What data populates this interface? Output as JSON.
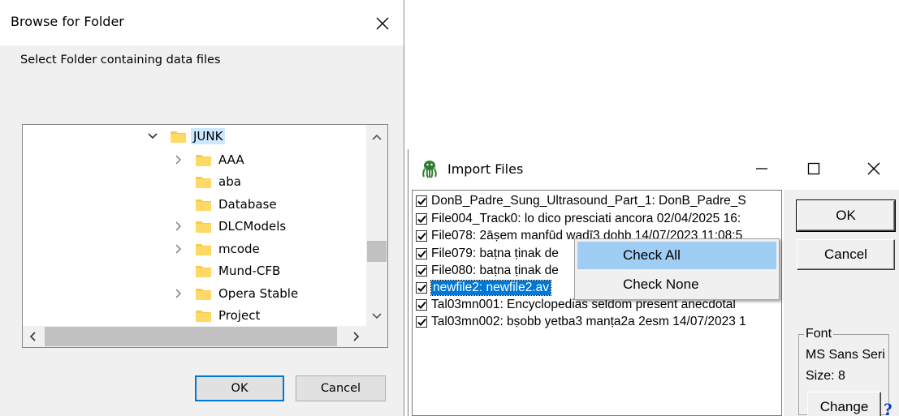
{
  "browse_dialog": {
    "title": "Browse for Folder",
    "prompt": "Select Folder containing data files",
    "tree": [
      {
        "label": "JUNK",
        "expanded": true,
        "selected": true,
        "level": 0
      },
      {
        "label": "AAA",
        "expandable": true,
        "level": 1
      },
      {
        "label": "aba",
        "expandable": false,
        "level": 1
      },
      {
        "label": "Database",
        "expandable": false,
        "level": 1
      },
      {
        "label": "DLCModels",
        "expandable": true,
        "level": 1
      },
      {
        "label": "mcode",
        "expandable": true,
        "level": 1
      },
      {
        "label": "Mund-CFB",
        "expandable": false,
        "level": 1
      },
      {
        "label": "Opera Stable",
        "expandable": true,
        "level": 1
      },
      {
        "label": "Project",
        "expandable": false,
        "level": 1
      }
    ],
    "ok_label": "OK",
    "cancel_label": "Cancel"
  },
  "import_dialog": {
    "title": "Import Files",
    "files": [
      {
        "text": "DonB_Padre_Sung_Ultrasound_Part_1: DonB_Padre_S",
        "checked": true
      },
      {
        "text": "File004_Track0: lo dico presciati ancora 02/04/2025 16:",
        "checked": true
      },
      {
        "text": "File078: 2āṣem manfūd wadī3 dohb 14/07/2023 11:08:5",
        "checked": true
      },
      {
        "text": "File079: baṭna ṭinak de",
        "checked": true
      },
      {
        "text": "File080: baṭna ṭinak de",
        "checked": true
      },
      {
        "text": "newfile2: newfile2.av",
        "checked": true,
        "highlighted": true
      },
      {
        "text": "Tal03mn001: Encyclopedias seldom present anecdotal",
        "checked": true
      },
      {
        "text": "Tal03mn002: bṣobb yetba3 manṭa2a 2esm 14/07/2023 1",
        "checked": true
      }
    ],
    "ok_label": "OK",
    "cancel_label": "Cancel",
    "font_group": {
      "legend": "Font",
      "font_name": "MS Sans Seri",
      "size_text": "Size: 8",
      "change_label": "Change"
    },
    "help_label": "?"
  },
  "context_menu": {
    "items": [
      {
        "label": "Check All",
        "hover": true
      },
      {
        "label": "Check None",
        "hover": false
      }
    ]
  },
  "colors": {
    "selection_blue": "#0078d7",
    "tree_selected": "#cce8ff",
    "menu_hover": "#9fcdf3",
    "folder_yellow": "#f8c94b",
    "help_blue": "#0033cc"
  }
}
